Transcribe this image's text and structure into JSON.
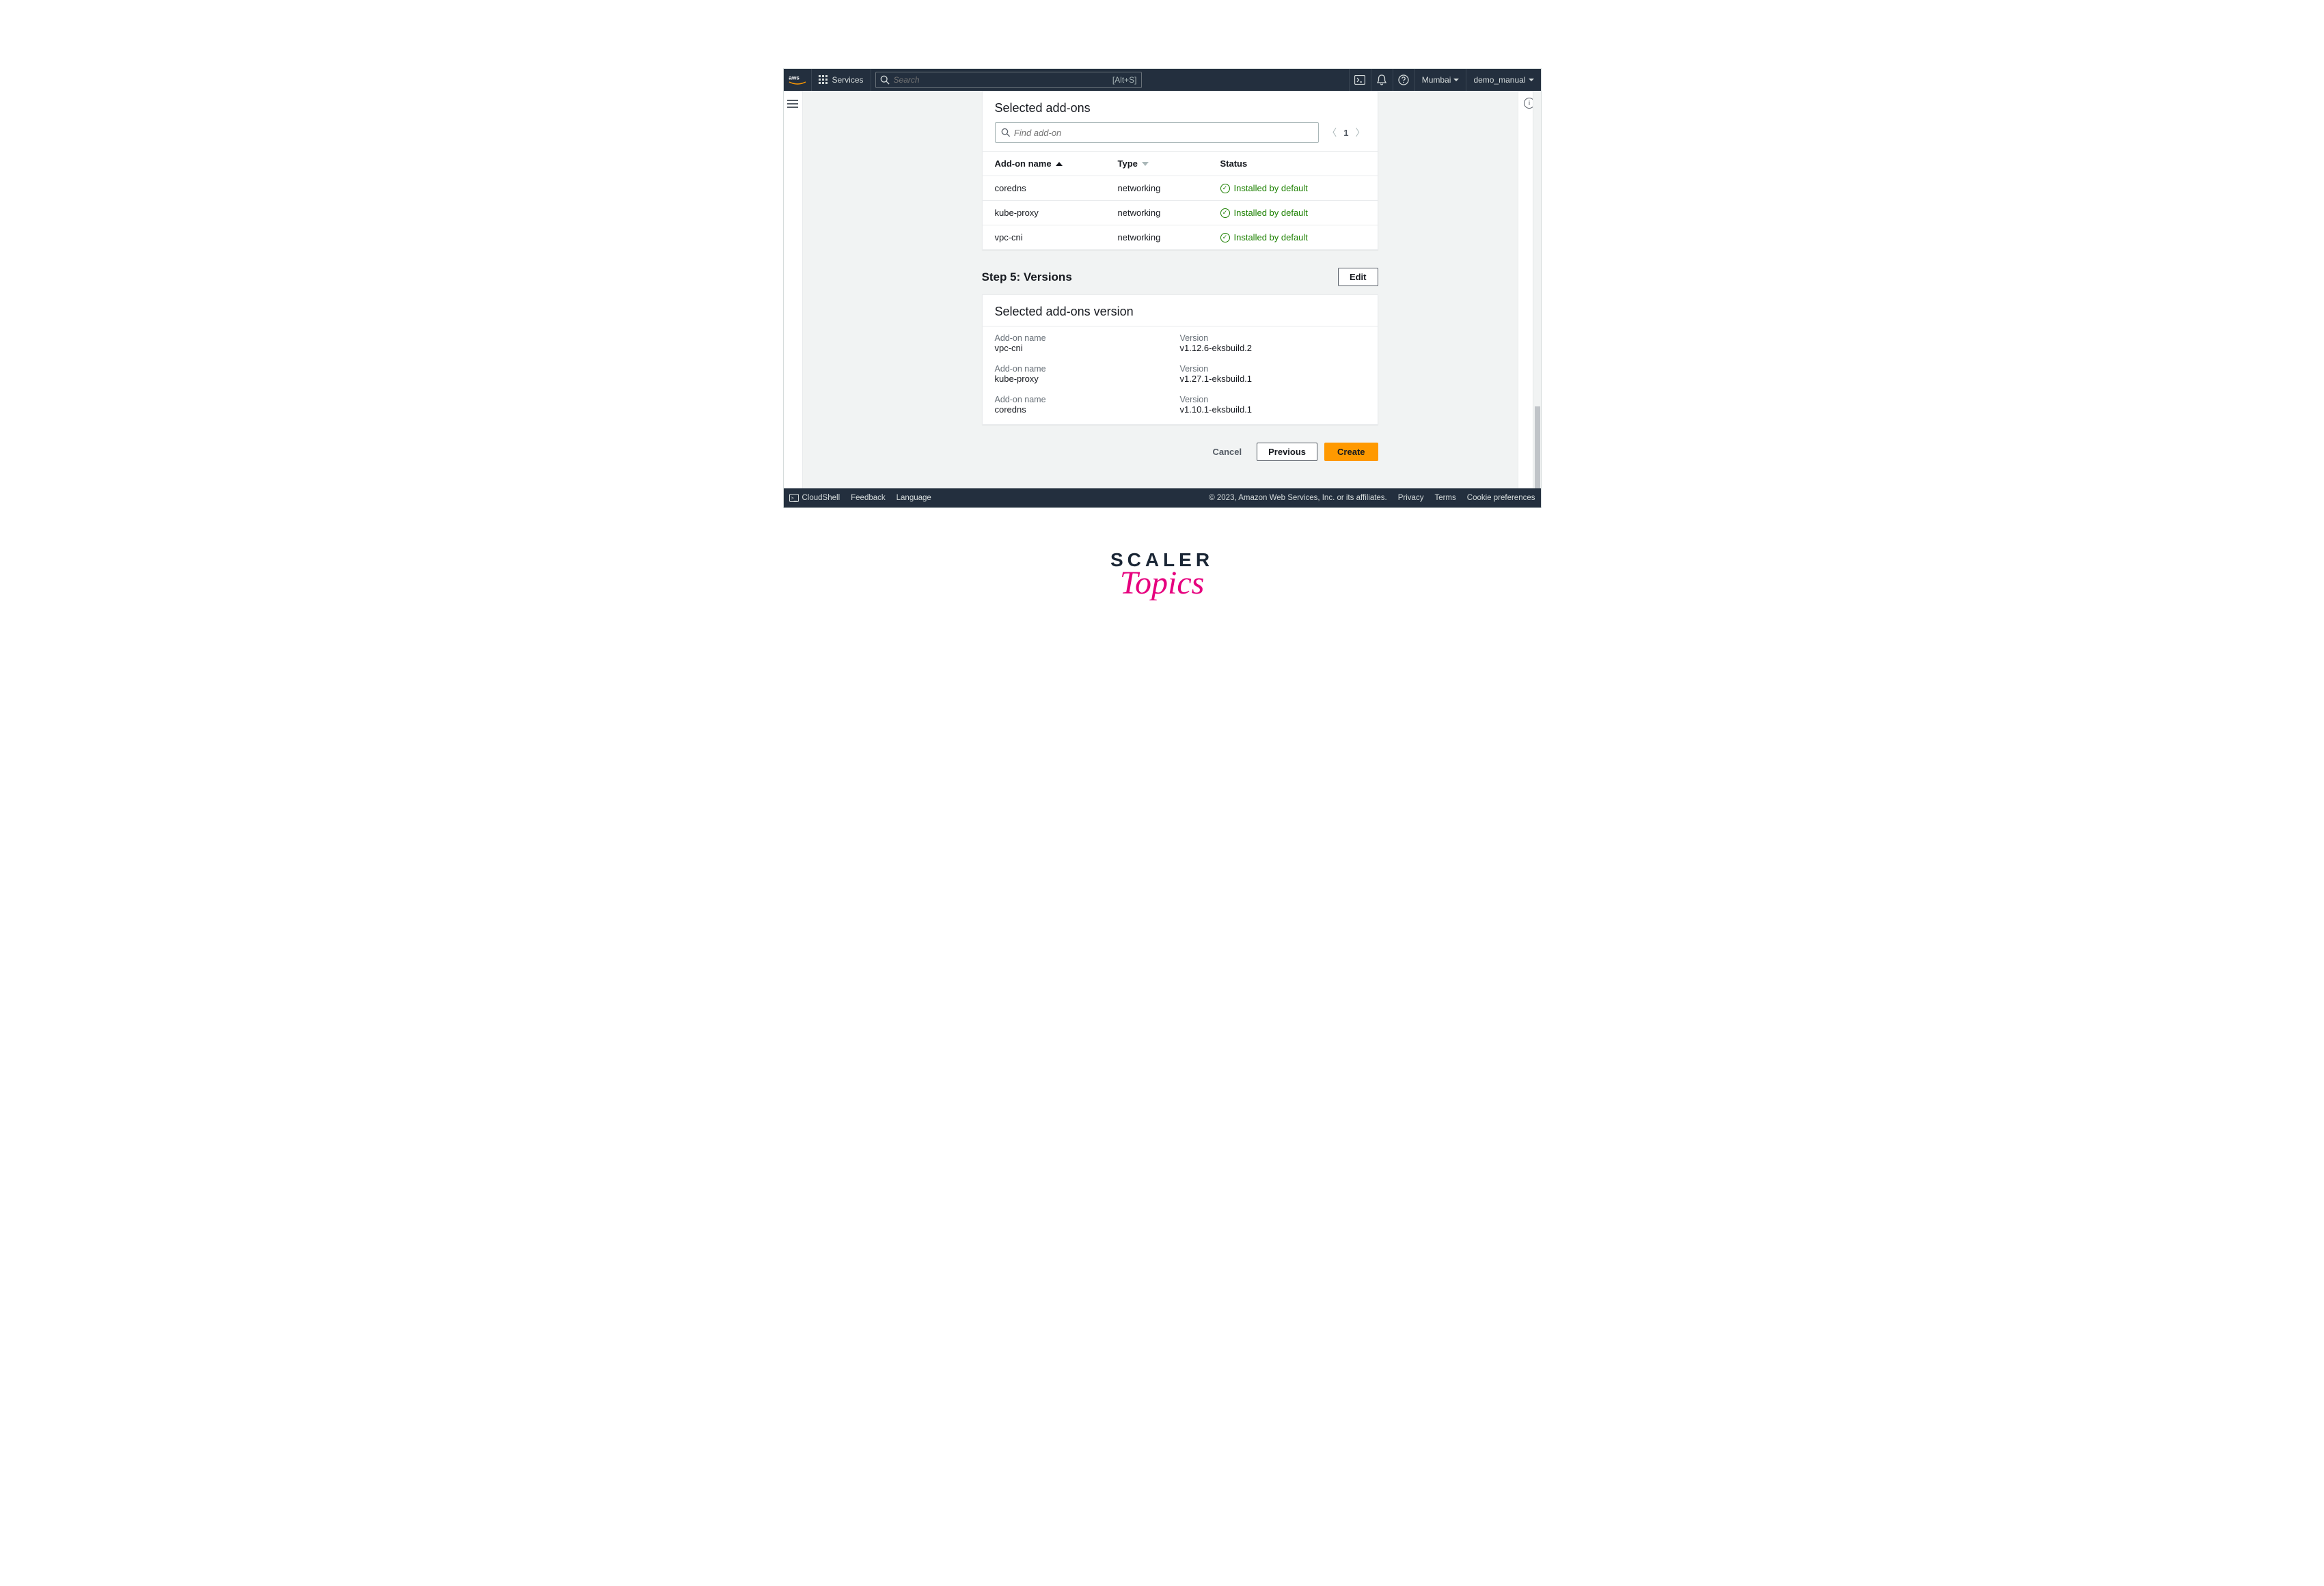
{
  "nav": {
    "services_label": "Services",
    "search_placeholder": "Search",
    "search_shortcut": "[Alt+S]",
    "region": "Mumbai",
    "user": "demo_manual"
  },
  "addons_card": {
    "title": "Selected add-ons",
    "search_placeholder": "Find add-on",
    "page": "1",
    "columns": {
      "name": "Add-on name",
      "type": "Type",
      "status": "Status"
    },
    "rows": [
      {
        "name": "coredns",
        "type": "networking",
        "status": "Installed by default"
      },
      {
        "name": "kube-proxy",
        "type": "networking",
        "status": "Installed by default"
      },
      {
        "name": "vpc-cni",
        "type": "networking",
        "status": "Installed by default"
      }
    ]
  },
  "step5": {
    "title": "Step 5: Versions",
    "edit_label": "Edit"
  },
  "versions_card": {
    "title": "Selected add-ons version",
    "labels": {
      "name": "Add-on name",
      "version": "Version"
    },
    "rows": [
      {
        "name": "vpc-cni",
        "version": "v1.12.6-eksbuild.2"
      },
      {
        "name": "kube-proxy",
        "version": "v1.27.1-eksbuild.1"
      },
      {
        "name": "coredns",
        "version": "v1.10.1-eksbuild.1"
      }
    ]
  },
  "actions": {
    "cancel": "Cancel",
    "previous": "Previous",
    "create": "Create"
  },
  "footer": {
    "cloudshell": "CloudShell",
    "feedback": "Feedback",
    "language": "Language",
    "copyright": "© 2023, Amazon Web Services, Inc. or its affiliates.",
    "privacy": "Privacy",
    "terms": "Terms",
    "cookies": "Cookie preferences"
  },
  "branding": {
    "line1": "SCALER",
    "line2": "Topics"
  }
}
